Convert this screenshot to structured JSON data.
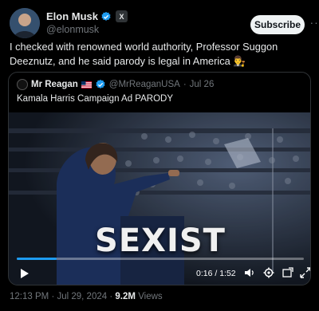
{
  "author": {
    "display_name": "Elon Musk",
    "handle": "@elonmusk",
    "badge": "X"
  },
  "actions": {
    "subscribe_label": "Subscribe",
    "more_label": "···"
  },
  "tweet": {
    "text": "I checked with renowned world authority, Professor Suggon Deeznutz, and he said parody is legal in America 👨‍⚖️"
  },
  "quote": {
    "display_name": "Mr Reagan",
    "flag": "US flag",
    "handle": "@MrReaganUSA",
    "separator": "·",
    "date": "Jul 26",
    "text": "Kamala Harris Campaign Ad PARODY",
    "video": {
      "overlay_text": "SEXIST",
      "time": "0:16 / 1:52",
      "progress": 0.14
    }
  },
  "footer": {
    "time": "12:13 PM",
    "separator": "·",
    "date": "Jul 29, 2024",
    "separator2": "·",
    "views_count": "9.2M",
    "views_label": "Views"
  },
  "colors": {
    "accent": "#1d9bf0",
    "background": "#000000",
    "secondary_text": "#71767b"
  }
}
